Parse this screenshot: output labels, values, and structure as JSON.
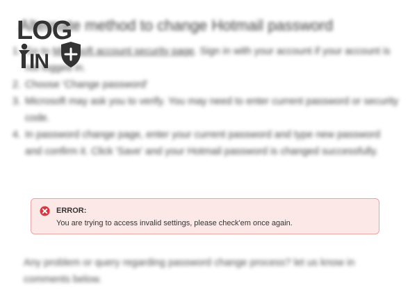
{
  "article": {
    "title": "Alternate method to change Hotmail password",
    "steps": [
      {
        "before": "Go to ",
        "link": "Microsoft account security page",
        "after": ". Sign in with your account if your account is not logged in."
      },
      {
        "before": "Choose 'Change password'",
        "link": "",
        "after": ""
      },
      {
        "before": "Microsoft may ask you to verify. You may need to enter current password or security code.",
        "link": "",
        "after": ""
      },
      {
        "before": "In password change page, enter your current password and type new password and confirm it. Click 'Save' and your Hotmail password is changed successfully.",
        "link": "",
        "after": ""
      }
    ],
    "footer": "Any problem or query regarding password change process? let us know in comments below."
  },
  "logo": {
    "line1": "LOG",
    "line2": "IN",
    "text_color": "#333333",
    "accent_color": "#ffffff"
  },
  "error": {
    "title": "ERROR:",
    "message": "You are trying to access invalid settings, please check'em once again.",
    "icon": "error-circle-x-icon",
    "background_color": "#fde8e8",
    "border_color": "#e9a4a4",
    "icon_color": "#d9363e"
  }
}
